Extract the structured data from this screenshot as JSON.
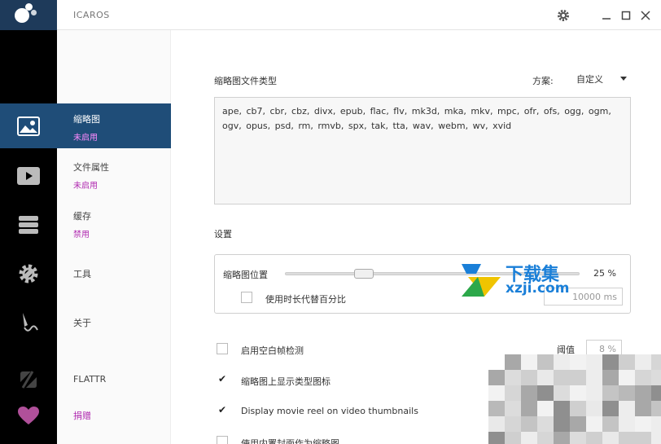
{
  "app": {
    "title": "ICAROS"
  },
  "nav": {
    "items": [
      {
        "label": "缩略图",
        "status": "未启用"
      },
      {
        "label": "文件属性",
        "status": "未启用"
      },
      {
        "label": "缓存",
        "status": "禁用"
      },
      {
        "label": "工具"
      },
      {
        "label": "关于"
      },
      {
        "label": "FLATTR"
      },
      {
        "label": "捐赠"
      }
    ]
  },
  "icons": {
    "nav": [
      "image-icon",
      "video-play-icon",
      "layers-icon",
      "gear-icon",
      "pen-icon",
      "flattr-icon",
      "heart-icon"
    ],
    "titlebar": [
      "gear-icon",
      "minimize-icon",
      "maximize-icon",
      "close-icon"
    ]
  },
  "thumbnails": {
    "filetypes_label": "缩略图文件类型",
    "scheme_label": "方案:",
    "scheme_value": "自定义",
    "filetypes": "ape, cb7, cbr, cbz, divx, epub, flac, flv, mk3d, mka, mkv, mpc, ofr, ofs, ogg, ogm, ogv, opus, psd, rm, rmvb, spx, tak, tta, wav, webm, wv, xvid",
    "settings_label": "设置",
    "position_label": "缩略图位置",
    "position_percent": "25 %",
    "position_fraction": 0.25,
    "use_duration_label": "使用时长代替百分比",
    "duration_value": "10000 ms",
    "blank_frame_label": "启用空白帧检测",
    "threshold_label": "阈值",
    "threshold_value": "8 %",
    "show_type_icon_label": "缩略图上显示类型图标",
    "movie_reel_label": "Display movie reel on video thumbnails",
    "cover_label": "使用内置封面作为缩略图"
  },
  "checkboxes": {
    "use_duration": false,
    "blank_frame": false,
    "show_type_icon": true,
    "movie_reel": true,
    "cover": false
  },
  "watermark": {
    "text": "下载集",
    "domain": "xzji.com"
  },
  "colors": {
    "accent": "#1f4d78",
    "status": "#b02ab0",
    "sidebar": "#000000"
  }
}
